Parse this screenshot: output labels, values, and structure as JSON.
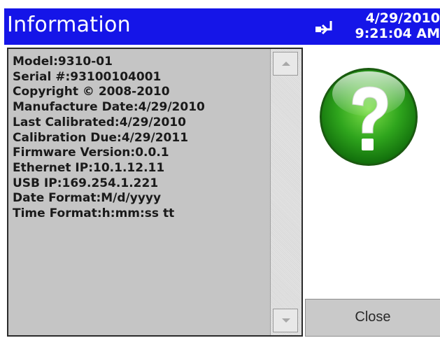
{
  "window": {
    "title": "Information",
    "date": "4/29/2010",
    "time": "9:21:04 AM",
    "title_bar_color": "#1515e8"
  },
  "icons": {
    "connection": "plug-icon",
    "help": "question-mark-icon",
    "help_color": "#2fa51d"
  },
  "info": {
    "lines": [
      "Model:9310-01",
      "Serial #:93100104001",
      "Copyright © 2008-2010",
      "Manufacture Date:4/29/2010",
      "Last Calibrated:4/29/2010",
      "Calibration Due:4/29/2011",
      "Firmware Version:0.0.1",
      "Ethernet IP:10.1.12.11",
      "USB IP:169.254.1.221",
      "Date Format:M/d/yyyy",
      "Time Format:h:mm:ss tt"
    ]
  },
  "buttons": {
    "close_label": "Close"
  }
}
